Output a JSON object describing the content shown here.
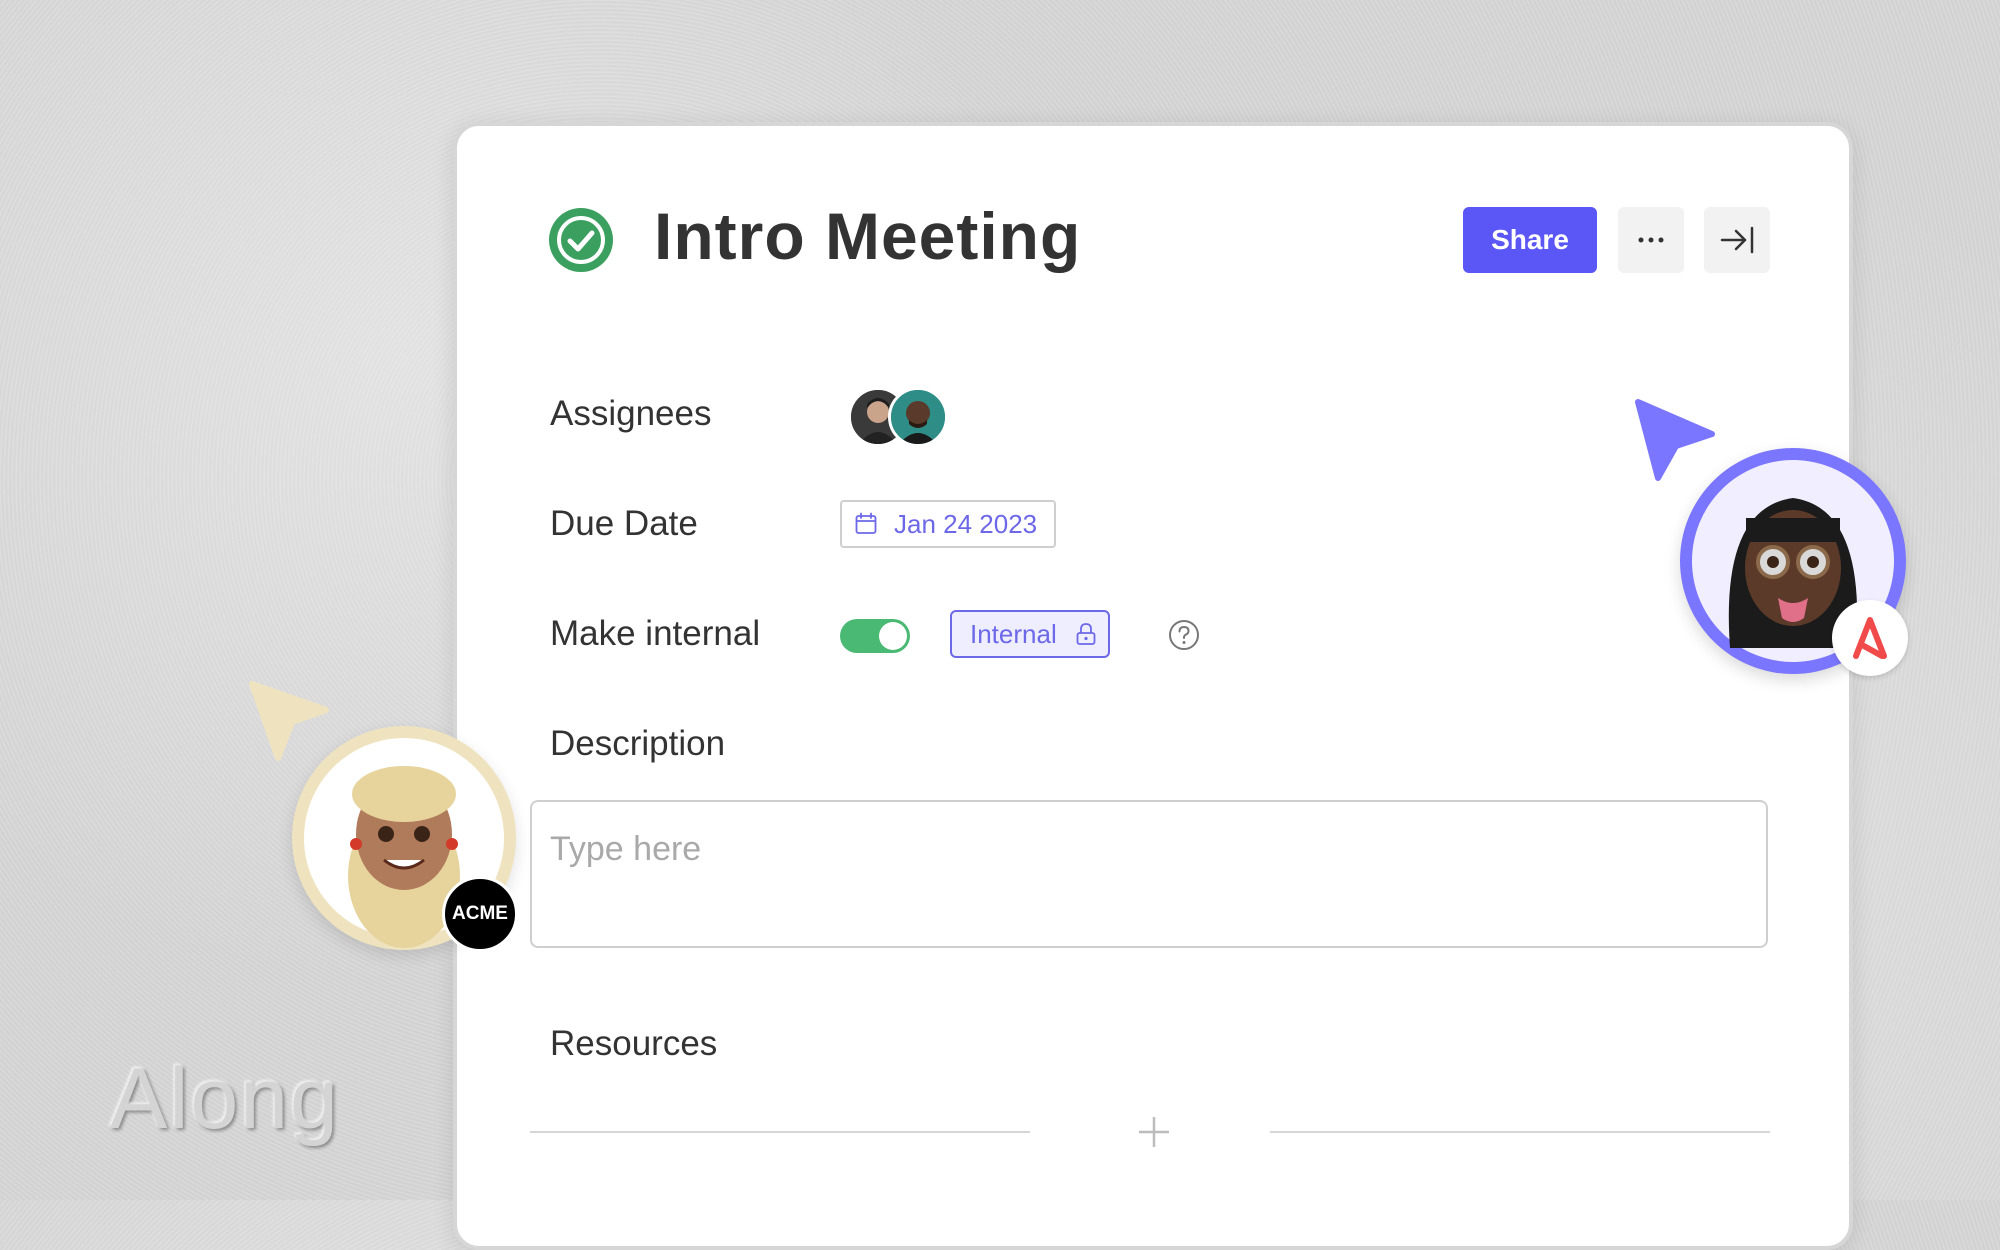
{
  "task": {
    "title": "Intro Meeting",
    "status_icon": "check-circle-icon",
    "status_color": "#3ba05f"
  },
  "toolbar": {
    "share_label": "Share",
    "more_icon": "more-horizontal-icon",
    "collapse_icon": "collapse-right-icon",
    "accent": "#5b56f6"
  },
  "fields": {
    "assignees_label": "Assignees",
    "due_date_label": "Due Date",
    "due_date_value": "Jan 24 2023",
    "make_internal_label": "Make internal",
    "make_internal_on": true,
    "internal_badge": "Internal",
    "description_label": "Description",
    "description_placeholder": "Type here",
    "description_value": "",
    "resources_label": "Resources"
  },
  "collaborators": {
    "left_badge": "ACME",
    "left_color": "#efe3bf",
    "right_color": "#7b76ff",
    "right_badge_color": "#f04a4a"
  },
  "brand": {
    "logo_text": "Along"
  }
}
